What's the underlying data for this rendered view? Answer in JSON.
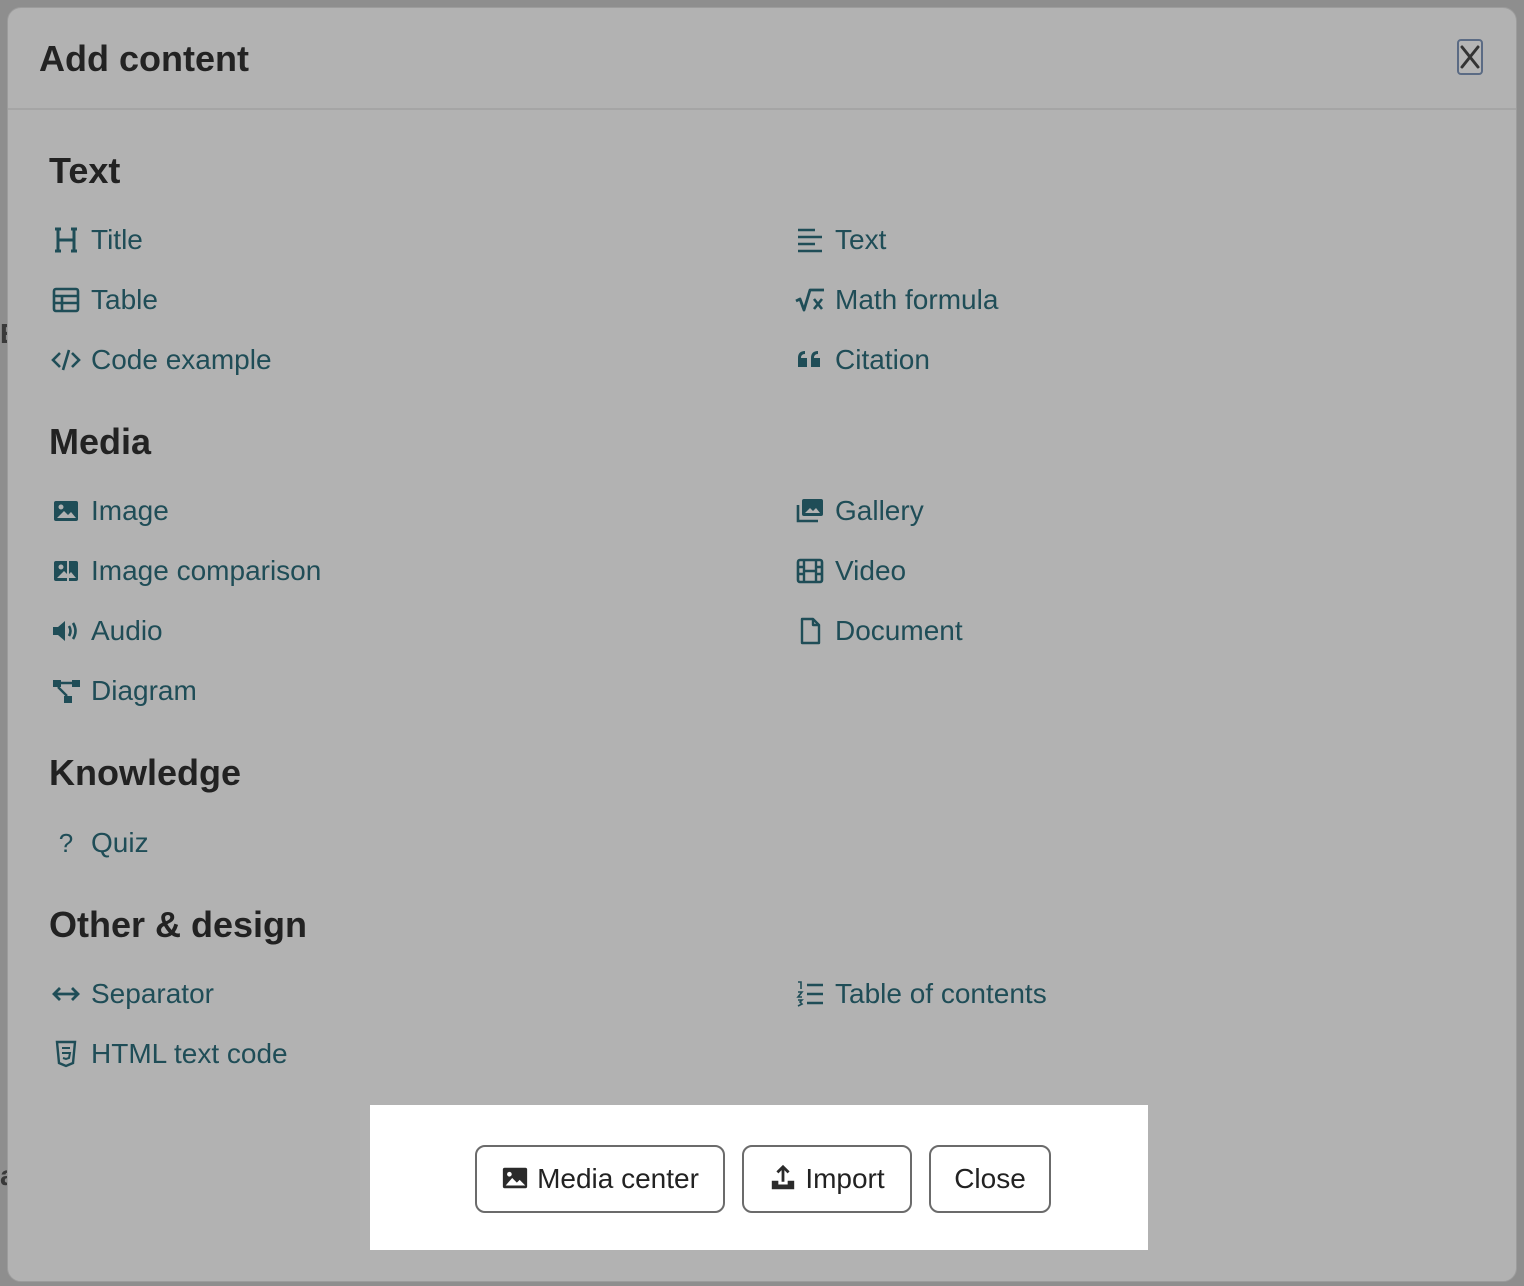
{
  "dialog": {
    "title": "Add content",
    "close_label": "×"
  },
  "sections": {
    "text": {
      "title": "Text",
      "items": [
        "Title",
        "Text",
        "Table",
        "Math formula",
        "Code example",
        "Citation"
      ]
    },
    "media": {
      "title": "Media",
      "items": [
        "Image",
        "Gallery",
        "Image comparison",
        "Video",
        "Audio",
        "Document",
        "Diagram"
      ]
    },
    "knowledge": {
      "title": "Knowledge",
      "items": [
        "Quiz"
      ]
    },
    "other": {
      "title": "Other & design",
      "items": [
        "Separator",
        "Table of contents",
        "HTML text code"
      ]
    }
  },
  "footer": {
    "media_center_label": "Media center",
    "import_label": "Import",
    "close_label": "Close"
  },
  "colors": {
    "accent": "#1f4d57",
    "overlay": "#b2b2b2",
    "footer_bg": "#ffffff"
  }
}
